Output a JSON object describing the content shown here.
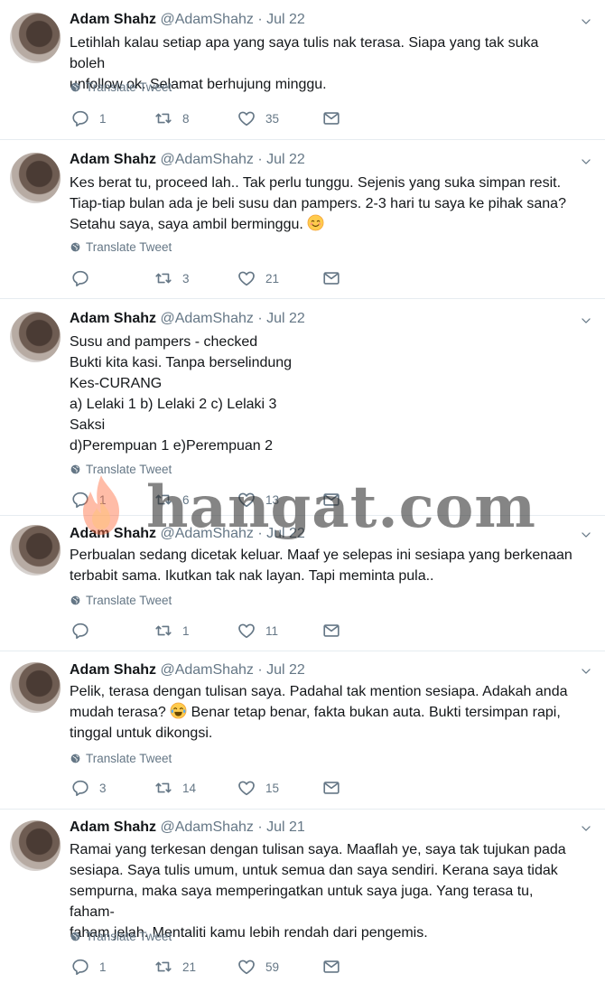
{
  "tweets": [
    {
      "name": "Adam Shahz",
      "handle": "@AdamShahz",
      "date": "· Jul 22",
      "text": "Letihlah kalau setiap apa yang saya tulis nak terasa. Siapa yang tak suka boleh\nunfollow ok. Selamat berhujung minggu.",
      "translate": "Translate Tweet",
      "replies": "1",
      "retweets": "8",
      "likes": "35"
    },
    {
      "name": "Adam Shahz",
      "handle": "@AdamShahz",
      "date": "· Jul 22",
      "text": "Kes berat tu, proceed lah.. Tak perlu tunggu. Sejenis yang suka simpan resit.\nTiap-tiap bulan ada je beli susu dan pampers. 2-3 hari tu saya ke pihak sana?\nSetahu saya, saya ambil berminggu. ",
      "emoji": "smiling-face-emoji",
      "translate": "Translate Tweet",
      "replies": "",
      "retweets": "3",
      "likes": "21"
    },
    {
      "name": "Adam Shahz",
      "handle": "@AdamShahz",
      "date": "· Jul 22",
      "text": "Susu and pampers - checked\nBukti kita kasi. Tanpa berselindung\nKes-CURANG\na) Lelaki 1 b) Lelaki 2 c) Lelaki 3\nSaksi\nd)Perempuan 1 e)Perempuan 2",
      "translate": "Translate Tweet",
      "replies": "1",
      "retweets": "6",
      "likes": "13"
    },
    {
      "name": "Adam Shahz",
      "handle": "@AdamShahz",
      "date": "· Jul 22",
      "text": "Perbualan sedang dicetak keluar. Maaf ye selepas ini sesiapa yang berkenaan\nterbabit sama. Ikutkan tak nak layan. Tapi meminta pula..",
      "translate": "Translate Tweet",
      "replies": "",
      "retweets": "1",
      "likes": "11"
    },
    {
      "name": "Adam Shahz",
      "handle": "@AdamShahz",
      "date": "· Jul 22",
      "text_before": "Pelik, terasa dengan tulisan saya. Padahal tak mention sesiapa. Adakah anda\nmudah terasa? ",
      "text_after": " Benar tetap benar, fakta bukan auta. Bukti tersimpan rapi,\ntinggal untuk dikongsi.",
      "emoji": "tears-of-joy-emoji",
      "translate": "Translate Tweet",
      "replies": "3",
      "retweets": "14",
      "likes": "15"
    },
    {
      "name": "Adam Shahz",
      "handle": "@AdamShahz",
      "date": "· Jul 21",
      "text": "Ramai yang terkesan dengan tulisan saya. Maaflah ye, saya tak tujukan pada\nsesiapa. Saya tulis umum, untuk semua dan saya sendiri. Kerana saya tidak\nsempurna, maka saya memperingatkan untuk saya juga. Yang terasa tu, faham-\nfaham jelah. Mentaliti kamu lebih rendah dari pengemis.",
      "translate": "Translate Tweet",
      "replies": "1",
      "retweets": "21",
      "likes": "59"
    }
  ],
  "watermark": {
    "text": "hangat.com",
    "logo": "flame-logo"
  },
  "colors": {
    "muted": "#657786",
    "text": "#14171a",
    "divider": "#e6ecf0"
  }
}
